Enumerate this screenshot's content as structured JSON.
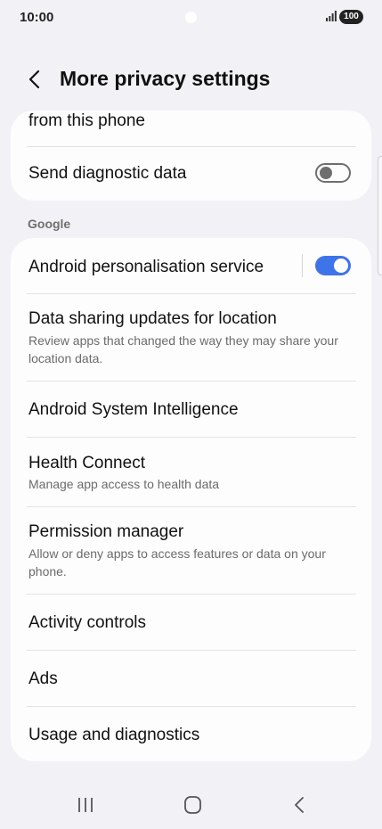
{
  "status": {
    "time": "10:00",
    "battery": "100"
  },
  "header": {
    "title": "More privacy settings"
  },
  "card1": {
    "partial_item": "from this phone",
    "diagnostic": {
      "label": "Send diagnostic data",
      "enabled": false
    }
  },
  "section_google": {
    "label": "Google"
  },
  "items": [
    {
      "title": "Android personalisation service",
      "enabled": true
    },
    {
      "title": "Data sharing updates for location",
      "subtitle": "Review apps that changed the way they may share your location data."
    },
    {
      "title": "Android System Intelligence"
    },
    {
      "title": "Health Connect",
      "subtitle": "Manage app access to health data"
    },
    {
      "title": "Permission manager",
      "subtitle": "Allow or deny apps to access features or data on your phone."
    },
    {
      "title": "Activity controls"
    },
    {
      "title": "Ads"
    },
    {
      "title": "Usage and diagnostics"
    }
  ],
  "icons": {
    "back": "chevron-left-icon",
    "nav_recents": "recents-icon",
    "nav_home": "home-icon",
    "nav_back": "back-icon"
  },
  "colors": {
    "accent": "#3f73ea",
    "background": "#f2f2f6",
    "card": "#fdfdfe"
  }
}
